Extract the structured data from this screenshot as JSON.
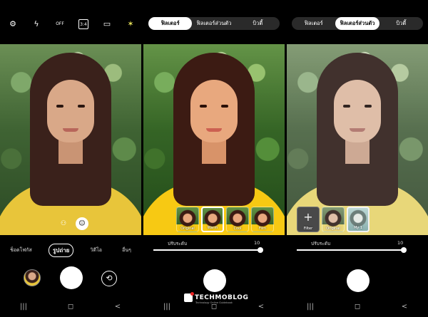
{
  "panel1": {
    "top_icons": [
      "settings-icon",
      "flash-off-icon",
      "timer-off-icon",
      "ratio-icon",
      "motion-photo-icon",
      "filter-effects-icon"
    ],
    "ratio_label": "3:4",
    "timer_label": "OFF",
    "modes": [
      "ช็อตโฟกัส",
      "รูปถ่าย",
      "วิดีโอ",
      "อื่นๆ"
    ],
    "active_mode": "รูปถ่าย"
  },
  "panel2": {
    "tabs": [
      "ฟิลเตอร์",
      "ฟิลเตอร์ส่วนตัว",
      "บิวตี้"
    ],
    "active_tab": "ฟิลเตอร์",
    "filters": [
      "Original",
      "Warm",
      "Cool",
      "Film"
    ],
    "selected_filter": "Warm",
    "intensity_label": "ปรับระดับ",
    "intensity_value": "10",
    "intensity_fraction": 1.0
  },
  "panel3": {
    "tabs": [
      "ฟิลเตอร์",
      "ฟิลเตอร์ส่วนตัว",
      "บิวตี้"
    ],
    "active_tab": "ฟิลเตอร์ส่วนตัว",
    "filters": [
      "Filter",
      "Original",
      "My 1"
    ],
    "selected_filter": "My 1",
    "intensity_label": "ปรับระดับ",
    "intensity_value": "10",
    "intensity_fraction": 1.0
  },
  "nav": [
    "|||",
    "◻",
    "<"
  ],
  "watermark": {
    "title": "TECHMOBLOG",
    "subtitle": "Technology Online Guidebook"
  }
}
